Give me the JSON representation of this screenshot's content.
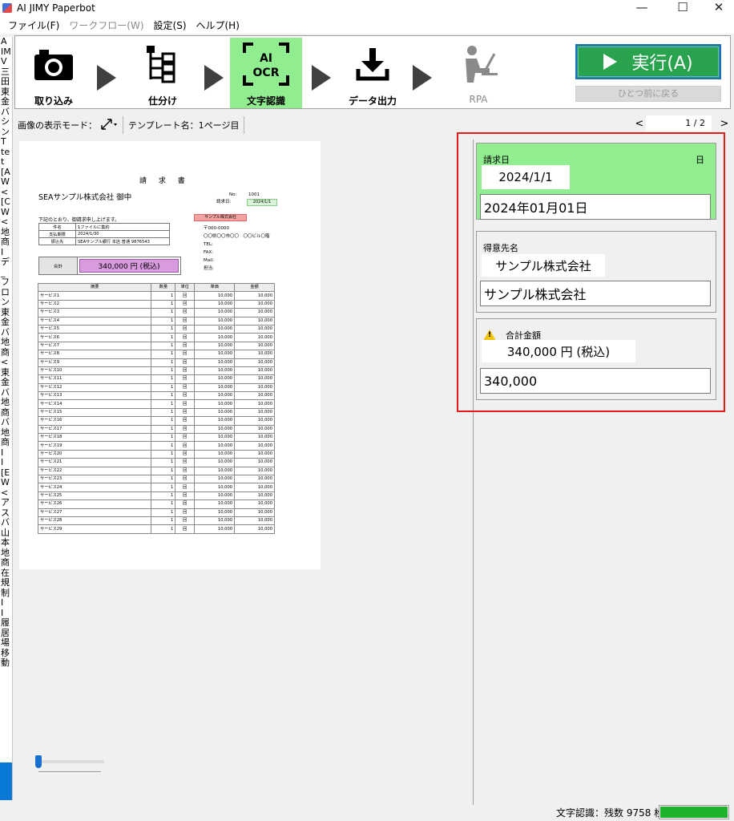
{
  "window": {
    "title": "AI JIMY Paperbot",
    "minimize": "—",
    "maximize": "☐",
    "close": "✕"
  },
  "menu": [
    {
      "label": "ファイル(F)",
      "enabled": true
    },
    {
      "label": "ワークフロー(W)",
      "enabled": false
    },
    {
      "label": "設定(S)",
      "enabled": true
    },
    {
      "label": "ヘルプ(H)",
      "enabled": true
    }
  ],
  "left_log": [
    "A",
    "IM",
    "V",
    "三",
    "田",
    "東",
    "金",
    "バ",
    "シ",
    "ン",
    "T",
    "te",
    "t",
    "",
    "[A",
    "W",
    "<",
    "[C",
    "W",
    "<",
    "地",
    "商",
    "I",
    "デ",
    "_",
    "フ",
    "ロ",
    "ン",
    "東",
    "金",
    "バ",
    "地",
    "商",
    "<",
    "東",
    "金",
    "バ",
    "地",
    "商",
    "バ",
    "地",
    "商",
    "I",
    "I",
    "[E",
    "W",
    "<",
    "ア",
    "ス",
    "バ",
    "山",
    "本",
    "地",
    "商",
    "在",
    "規",
    "制",
    "I",
    "I",
    "履",
    "居",
    "場",
    "移",
    "動"
  ],
  "toolbar": {
    "steps": [
      {
        "label": "取り込み",
        "icon": "camera-icon"
      },
      {
        "label": "仕分け",
        "icon": "sort-tree-icon"
      },
      {
        "label": "文字認識",
        "icon": "ai-ocr-icon",
        "icon_text_1": "AI",
        "icon_text_2": "OCR"
      },
      {
        "label": "データ出力",
        "icon": "download-icon"
      },
      {
        "label": "RPA",
        "icon": "rpa-worker-icon"
      }
    ],
    "run_label": "実行(A)",
    "back_label": "ひとつ前に戻る"
  },
  "viewbar": {
    "display_mode_label": "画像の表示モード：",
    "template_label": "テンプレート名：1ページ目",
    "page_prev": "<",
    "page_indicator": "1 / 2",
    "page_next": ">"
  },
  "document": {
    "title": "請 求 書",
    "client": "SEAサンプル株式会社 御中",
    "no_label": "No:",
    "no_value": "1001",
    "date_label": "請求日:",
    "date_value": "2024/1/1",
    "intro": "下記のとおり、御請求申し上げます。",
    "info_rows": [
      {
        "key": "件名",
        "value": "1ファイルに集約"
      },
      {
        "key": "支払期限",
        "value": "2024/1/30"
      },
      {
        "key": "振込先",
        "value": "SEAサンプル銀行 本店 普通 9876543"
      }
    ],
    "seller_name": "サンプル株式会社",
    "seller_lines": [
      "〒000-0000",
      "〇〇県〇〇市〇〇　〇〇ビル〇階",
      "TEL:",
      "FAX:",
      "Mail:",
      "担当:"
    ],
    "total_label": "合計",
    "total_value": "340,000 円 (税込)",
    "table_headers": [
      "摘要",
      "数量",
      "単位",
      "単価",
      "金額"
    ],
    "rows": [
      [
        "サービス1",
        "1",
        "回",
        "10,000",
        "10,000"
      ],
      [
        "サービス2",
        "1",
        "回",
        "10,000",
        "10,000"
      ],
      [
        "サービス3",
        "1",
        "回",
        "10,000",
        "10,000"
      ],
      [
        "サービス4",
        "1",
        "回",
        "10,000",
        "10,000"
      ],
      [
        "サービス5",
        "1",
        "回",
        "10,000",
        "10,000"
      ],
      [
        "サービス6",
        "1",
        "回",
        "10,000",
        "10,000"
      ],
      [
        "サービス7",
        "1",
        "回",
        "10,000",
        "10,000"
      ],
      [
        "サービス8",
        "1",
        "回",
        "10,000",
        "10,000"
      ],
      [
        "サービス9",
        "1",
        "回",
        "10,000",
        "10,000"
      ],
      [
        "サービス10",
        "1",
        "回",
        "10,000",
        "10,000"
      ],
      [
        "サービス11",
        "1",
        "回",
        "10,000",
        "10,000"
      ],
      [
        "サービス12",
        "1",
        "回",
        "10,000",
        "10,000"
      ],
      [
        "サービス13",
        "1",
        "回",
        "10,000",
        "10,000"
      ],
      [
        "サービス14",
        "1",
        "回",
        "10,000",
        "10,000"
      ],
      [
        "サービス15",
        "1",
        "回",
        "10,000",
        "10,000"
      ],
      [
        "サービス16",
        "1",
        "回",
        "10,000",
        "10,000"
      ],
      [
        "サービス17",
        "1",
        "回",
        "10,000",
        "10,000"
      ],
      [
        "サービス18",
        "1",
        "回",
        "10,000",
        "10,000"
      ],
      [
        "サービス19",
        "1",
        "回",
        "10,000",
        "10,000"
      ],
      [
        "サービス20",
        "1",
        "回",
        "10,000",
        "10,000"
      ],
      [
        "サービス21",
        "1",
        "回",
        "10,000",
        "10,000"
      ],
      [
        "サービス22",
        "1",
        "回",
        "10,000",
        "10,000"
      ],
      [
        "サービス23",
        "1",
        "回",
        "10,000",
        "10,000"
      ],
      [
        "サービス24",
        "1",
        "回",
        "10,000",
        "10,000"
      ],
      [
        "サービス25",
        "1",
        "回",
        "10,000",
        "10,000"
      ],
      [
        "サービス26",
        "1",
        "回",
        "10,000",
        "10,000"
      ],
      [
        "サービス27",
        "1",
        "回",
        "10,000",
        "10,000"
      ],
      [
        "サービス28",
        "1",
        "回",
        "10,000",
        "10,000"
      ],
      [
        "サービス29",
        "1",
        "回",
        "10,000",
        "10,000"
      ]
    ]
  },
  "fields": {
    "invoice_date": {
      "label": "請求日",
      "unit": "日",
      "crop_text": "2024/1/1",
      "value": "2024年01月01日",
      "confirmed": true
    },
    "customer": {
      "label": "得意先名",
      "crop_text": "サンプル株式会社",
      "value": "サンプル株式会社",
      "confirmed": false
    },
    "total": {
      "label": "合計金額",
      "crop_text": "340,000 円 (税込)",
      "value": "340,000",
      "warning": true
    }
  },
  "status": {
    "text": "文字認識：残数 9758 枚",
    "progress": 1.0,
    "progress_color": "#1fb32c"
  },
  "colors": {
    "accent_run": "#2aa34f",
    "confirmed_field": "#90ee90",
    "highlight_frame": "#e21b1b",
    "active_step": "#90ee90"
  }
}
